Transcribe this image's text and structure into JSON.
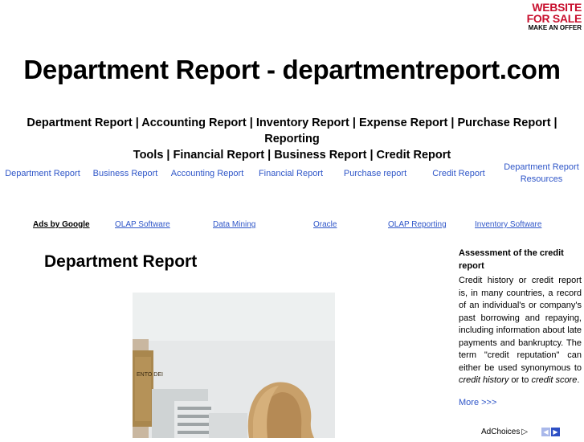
{
  "sale_badge": {
    "line1": "WEBSITE",
    "line2": "FOR SALE",
    "line3": "MAKE AN OFFER"
  },
  "site_title": "Department Report - departmentreport.com",
  "keywords": [
    "Department Report",
    "Accounting Report",
    "Inventory Report",
    "Expense Report",
    "Purchase Report",
    "Reporting Tools",
    "Financial Report",
    "Business Report",
    "Credit Report"
  ],
  "keyword_line": {
    "line1": "Department Report | Accounting Report | Inventory Report | Expense Report | Purchase Report | Reporting",
    "line2": "Tools | Financial Report | Business Report | Credit Report"
  },
  "nav": [
    {
      "label": "Department Report"
    },
    {
      "label": "Business Report"
    },
    {
      "label": "Accounting Report"
    },
    {
      "label": "Financial Report"
    },
    {
      "label": "Purchase report"
    },
    {
      "label": "Credit Report"
    },
    {
      "label": "Department Report Resources"
    }
  ],
  "ads": {
    "label": "Ads by Google",
    "links": [
      "OLAP Software",
      "Data Mining",
      "Oracle",
      "OLAP Reporting",
      "Inventory Software"
    ]
  },
  "content_heading": "Department Report",
  "photo": {
    "sign_text": "ENTO DEI"
  },
  "sidebar": {
    "title": "Assessment of the credit report",
    "body_pre": "Credit history or credit report is, in many countries, a record of an individual's or company's past borrowing and repaying, including information about late payments and bankruptcy. The term \"credit reputation\" can either be used synonymous to ",
    "em1": "credit history",
    "body_mid": " or to ",
    "em2": "credit score",
    "body_end": ".",
    "more": "More >>>"
  },
  "adchoices": {
    "label": "AdChoices"
  },
  "colors": {
    "link": "#2f56c8",
    "badge_red": "#c8102e",
    "arrow_left": "#a9b8ea",
    "arrow_right": "#2d4fc4"
  }
}
